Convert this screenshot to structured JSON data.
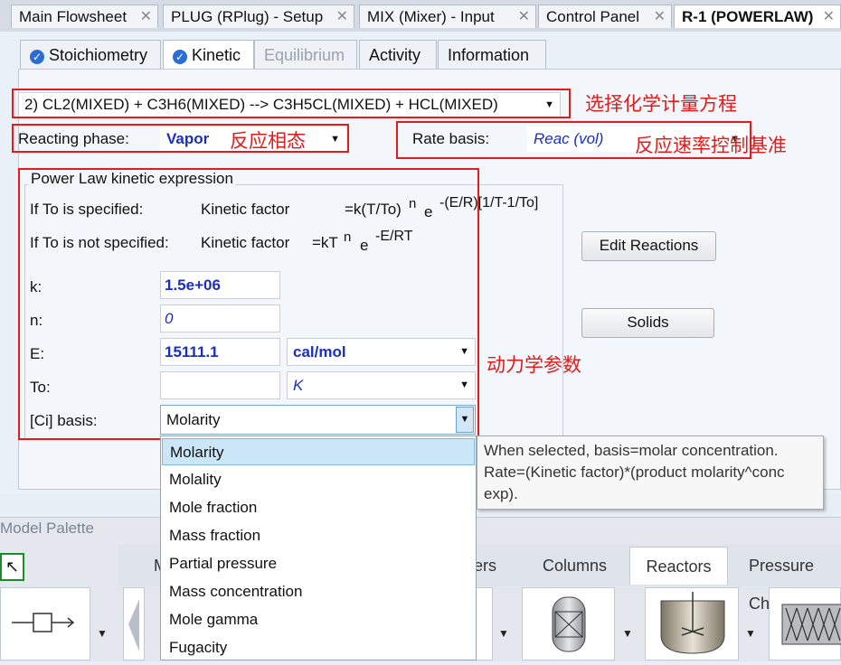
{
  "doc_tabs": [
    {
      "label": "Main Flowsheet"
    },
    {
      "label": "PLUG (RPlug) - Setup"
    },
    {
      "label": "MIX (Mixer) - Input"
    },
    {
      "label": "Control Panel"
    },
    {
      "label": "R-1 (POWERLAW)"
    }
  ],
  "close_glyph": "✕",
  "form_tabs": [
    {
      "label": "Stoichiometry",
      "state": "checked"
    },
    {
      "label": "Kinetic",
      "state": "checked-active"
    },
    {
      "label": "Equilibrium",
      "state": "disabled"
    },
    {
      "label": "Activity"
    },
    {
      "label": "Information"
    }
  ],
  "reaction_select": "2) CL2(MIXED)  + C3H6(MIXED)   -->  C3H5CL(MIXED) + HCL(MIXED)",
  "reacting_phase": {
    "label": "Reacting phase:",
    "value": "Vapor"
  },
  "rate_basis": {
    "label": "Rate basis:",
    "value": "Reac (vol)"
  },
  "power_law": {
    "title": "Power Law kinetic expression",
    "to_specified": {
      "label": "If To is specified:",
      "factor_label": "Kinetic factor",
      "eq_base": "=k(T/To)",
      "n": "n",
      "e": "e",
      "exp": "-(E/R)[1/T-1/To]"
    },
    "to_not_specified": {
      "label": "If To is not specified:",
      "factor_label": "Kinetic factor",
      "eq_base": "=kT",
      "n": "n",
      "e": "e",
      "exp": "-E/RT"
    },
    "k": {
      "label": "k:",
      "value": "1.5e+06"
    },
    "n": {
      "label": "n:",
      "value": "0"
    },
    "E": {
      "label": "E:",
      "value": "15111.1",
      "unit": "cal/mol"
    },
    "To": {
      "label": "To:",
      "value": "",
      "unit": "K"
    },
    "ci_basis": {
      "label": "[Ci] basis:",
      "value": "Molarity"
    }
  },
  "buttons": {
    "edit_reactions": "Edit Reactions",
    "solids": "Solids"
  },
  "annotations": {
    "reaction": "选择化学计量方程",
    "phase": "反应相态",
    "rate_basis": "反应速率控制基准",
    "kinetics": "动力学参数"
  },
  "ci_basis_options": [
    "Molarity",
    "Molality",
    "Mole fraction",
    "Mass fraction",
    "Partial pressure",
    "Mass concentration",
    "Mole gamma",
    "Fugacity"
  ],
  "tooltip": "When selected, basis=molar concentration. Rate=(Kinetic factor)*(product molarity^conc exp).",
  "palette": {
    "title": "Model Palette",
    "tabs": [
      {
        "label": "M"
      },
      {
        "label": "gers"
      },
      {
        "label": "Columns"
      },
      {
        "label": "Reactors",
        "active": true
      },
      {
        "label": "Pressure Cha"
      }
    ]
  },
  "colors": {
    "annotation_red": "#e31b1b",
    "value_blue": "#1a2fbf",
    "selection_bg": "#cbe6f7"
  }
}
